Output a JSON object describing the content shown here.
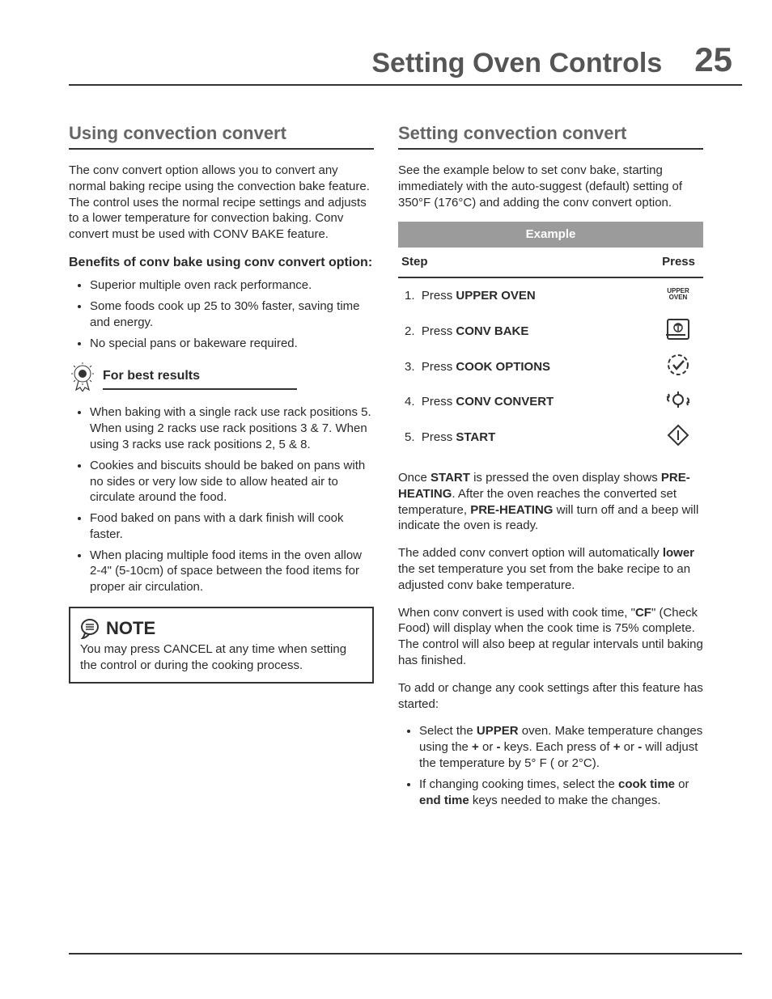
{
  "header": {
    "title": "Setting Oven Controls",
    "page_number": "25"
  },
  "left": {
    "h": "Using convection convert",
    "intro": "The conv convert option allows you to convert any normal baking recipe using the convection bake feature. The control uses the normal recipe settings and adjusts to a lower temperature for convection baking. Conv convert must be used with CONV BAKE feature.",
    "benefits_h": "Benefits of conv bake using conv convert option:",
    "benefits": [
      "Superior multiple oven rack performance.",
      "Some foods cook up 25 to 30% faster, saving time and energy.",
      "No special pans or bakeware required."
    ],
    "best_h": "For best results",
    "best": [
      "When baking with a single rack use rack positions 5. When using 2 racks use rack positions 3 & 7. When using 3 racks use rack positions 2, 5 & 8.",
      "Cookies and biscuits should be baked on pans with no sides or very low side to allow heated air to circulate around the food.",
      "Food baked on pans with a dark finish will cook faster.",
      "When placing multiple food items in the oven allow 2-4\" (5-10cm) of space between the food items for proper air circulation."
    ],
    "note_label": "NOTE",
    "note": "You may press CANCEL at any time when setting the control or during the cooking process."
  },
  "right": {
    "h": "Setting convection convert",
    "intro": "See the example below to set conv bake, starting immediately with the auto-suggest (default) setting of 350°F (176°C) and adding the conv convert option.",
    "table": {
      "title": "Example",
      "col_step": "Step",
      "col_press": "Press",
      "rows": [
        {
          "n": "1.",
          "pre": "Press ",
          "b": "UPPER OVEN",
          "icon": "upper-oven"
        },
        {
          "n": "2.",
          "pre": "Press ",
          "b": "CONV BAKE",
          "icon": "conv-bake"
        },
        {
          "n": "3.",
          "pre": "Press ",
          "b": "COOK OPTIONS",
          "icon": "cook-options"
        },
        {
          "n": "4.",
          "pre": "Press ",
          "b": "CONV CONVERT",
          "icon": "conv-convert"
        },
        {
          "n": "5.",
          "pre": "Press ",
          "b": "START",
          "icon": "start"
        }
      ]
    },
    "p1a": "Once ",
    "p1b": "START",
    "p1c": " is pressed the oven display shows ",
    "p1d": "PRE-HEATING",
    "p1e": ". After the oven reaches the converted set temperature, ",
    "p1f": "PRE-HEATING",
    "p1g": " will turn off and a beep will indicate the oven is ready.",
    "p2a": "The added conv convert option will automatically ",
    "p2b": "lower",
    "p2c": " the set temperature you set from the bake recipe to an adjusted conv bake temperature.",
    "p3a": "When conv convert is used with cook time, \"",
    "p3b": "CF",
    "p3c": "\" (Check Food) will display when the cook time is 75% complete. The control will also beep at regular intervals until baking has finished.",
    "p4": "To add or change any cook settings after this feature has started:",
    "list": [
      {
        "a": "Select the ",
        "b": "UPPER",
        "c": " oven. Make temperature changes using the ",
        "d": "+",
        "e": " or ",
        "f": "-",
        "g": " keys. Each press of ",
        "h": "+",
        "i": " or ",
        "j": "-",
        "k": " will adjust the temperature by 5° F ( or 2°C)."
      },
      {
        "a": "If changing cooking times, select the ",
        "b": "cook time",
        "c": " or ",
        "d": "end time",
        "e": " keys needed to make the changes."
      }
    ]
  }
}
